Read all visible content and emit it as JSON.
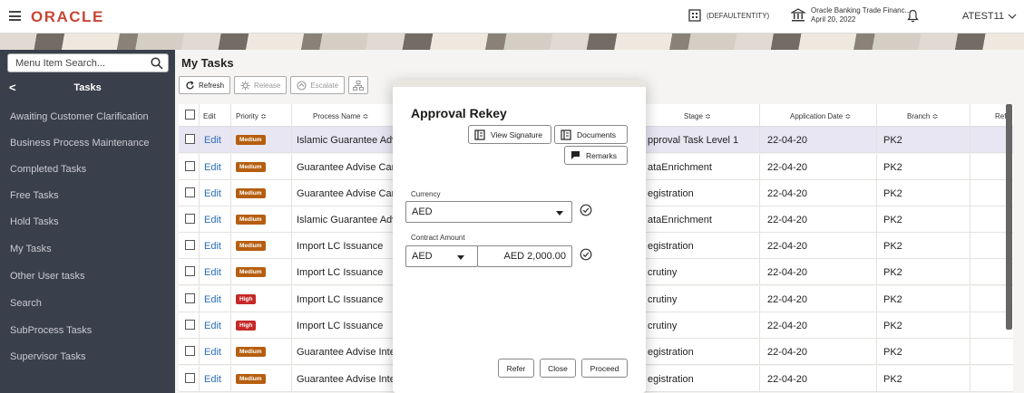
{
  "header": {
    "logo": "ORACLE",
    "entity": "(DEFAULTENTITY)",
    "bank_name": "Oracle Banking Trade Financ...",
    "bank_date": "April 20, 2022",
    "user": "ATEST11"
  },
  "sidebar": {
    "search_placeholder": "Menu Item Search...",
    "heading": "Tasks",
    "items": [
      "Awaiting Customer Clarification",
      "Business Process Maintenance",
      "Completed Tasks",
      "Free Tasks",
      "Hold Tasks",
      "My Tasks",
      "Other User tasks",
      "Search",
      "SubProcess Tasks",
      "Supervisor Tasks"
    ]
  },
  "main": {
    "title": "My Tasks",
    "toolbar": {
      "refresh": "Refresh",
      "release": "Release",
      "escalate": "Escalate"
    }
  },
  "table": {
    "headers": {
      "edit": "Edit",
      "priority": "Priority ≎",
      "process_name": "Process Name ≎",
      "stage": "Stage ≎",
      "application_date": "Application Date ≎",
      "branch": "Branch ≎",
      "reference": "Refe"
    },
    "rows": [
      {
        "edit": "Edit",
        "priority": "Medium",
        "process": "Islamic Guarantee Adv..",
        "stage": "pproval Task Level 1",
        "date": "22-04-20",
        "branch": "PK2"
      },
      {
        "edit": "Edit",
        "priority": "Medium",
        "process": "Guarantee Advise Can..",
        "stage": "ataEnrichment",
        "date": "22-04-20",
        "branch": "PK2"
      },
      {
        "edit": "Edit",
        "priority": "Medium",
        "process": "Guarantee Advise Can..",
        "stage": "egistration",
        "date": "22-04-20",
        "branch": "PK2"
      },
      {
        "edit": "Edit",
        "priority": "Medium",
        "process": "Islamic Guarantee Adv..",
        "stage": "ataEnrichment",
        "date": "22-04-20",
        "branch": "PK2"
      },
      {
        "edit": "Edit",
        "priority": "Medium",
        "process": "Import LC Issuance",
        "stage": "egistration",
        "date": "22-04-20",
        "branch": "PK2"
      },
      {
        "edit": "Edit",
        "priority": "Medium",
        "process": "Import LC Issuance",
        "stage": "crutiny",
        "date": "22-04-20",
        "branch": "PK2"
      },
      {
        "edit": "Edit",
        "priority": "High",
        "process": "Import LC Issuance",
        "stage": "crutiny",
        "date": "22-04-20",
        "branch": "PK2"
      },
      {
        "edit": "Edit",
        "priority": "High",
        "process": "Import LC Issuance",
        "stage": "crutiny",
        "date": "22-04-20",
        "branch": "PK2"
      },
      {
        "edit": "Edit",
        "priority": "Medium",
        "process": "Guarantee Advise Inte..",
        "stage": "egistration",
        "date": "22-04-20",
        "branch": "PK2"
      },
      {
        "edit": "Edit",
        "priority": "Medium",
        "process": "Guarantee Advise Inte..",
        "stage": "egistration",
        "date": "22-04-20",
        "branch": "PK2"
      }
    ]
  },
  "modal": {
    "title": "Approval Rekey",
    "view_signature": "View Signature",
    "documents": "Documents",
    "remarks": "Remarks",
    "currency_label": "Currency",
    "currency_value": "AED",
    "contract_amount_label": "Contract Amount",
    "contract_currency": "AED",
    "contract_amount": "AED 2,000.00",
    "refer": "Refer",
    "close": "Close",
    "proceed": "Proceed"
  },
  "colors": {
    "brand": "#c74634",
    "sidebar_bg": "#3a3f4c",
    "medium_badge": "#b65e0f",
    "high_badge": "#c62828",
    "link": "#2a6ebb"
  }
}
